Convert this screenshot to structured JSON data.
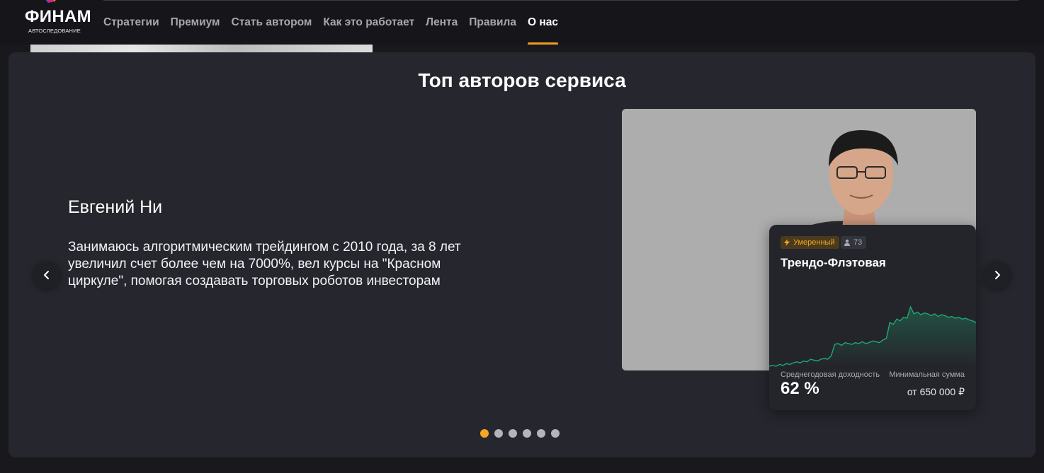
{
  "brand": {
    "name": "ФИНАМ",
    "subtitle": "АВТОСЛЕДОВАНИЕ",
    "colors": {
      "mark_orange": "#f5a623",
      "mark_purple": "#8e3bd6",
      "mark_red": "#e0245e"
    }
  },
  "nav": {
    "items": [
      {
        "label": "Стратегии",
        "active": false
      },
      {
        "label": "Премиум",
        "active": false
      },
      {
        "label": "Стать автором",
        "active": false
      },
      {
        "label": "Как это работает",
        "active": false
      },
      {
        "label": "Лента",
        "active": false
      },
      {
        "label": "Правила",
        "active": false
      },
      {
        "label": "О нас",
        "active": true
      }
    ],
    "active_color": "#f49b23"
  },
  "section": {
    "title": "Топ авторов сервиса"
  },
  "author": {
    "name": "Евгений Ни",
    "bio": "Занимаюсь алгоритмическим трейдингом с 2010 года, за 8 лет увеличил счет более чем на 7000%, вел курсы на \"Красном циркуле\", помогая создавать торговых роботов инвесторам"
  },
  "strategy": {
    "risk_label": "Умеренный",
    "risk_icon": "lightning-icon",
    "subscribers": "73",
    "subscribers_icon": "user-icon",
    "name": "Трендо-Флэтовая",
    "yield_label": "Среднегодовая доходность",
    "yield_value": "62 %",
    "min_label": "Минимальная сумма",
    "min_value": "от 650 000 ₽",
    "line_color": "#1fa971"
  },
  "carousel": {
    "prev_icon": "chevron-left-icon",
    "next_icon": "chevron-right-icon",
    "slides_total": 6,
    "active_slide": 1,
    "dot_active_color": "#f5a623"
  },
  "chart_data": {
    "type": "area",
    "title": "",
    "xlabel": "",
    "ylabel": "",
    "series": [
      {
        "values": [
          10,
          11,
          10,
          12,
          11,
          13,
          12,
          14,
          15,
          14,
          16,
          15,
          18,
          17,
          16,
          18,
          19,
          18,
          22,
          35,
          36,
          34,
          37,
          36,
          35,
          37,
          36,
          38,
          36,
          37,
          39,
          38,
          37,
          40,
          42,
          60,
          58,
          64,
          62,
          66,
          65,
          78,
          70,
          72,
          69,
          71,
          70,
          68,
          70,
          67,
          69,
          68,
          66,
          67,
          65,
          66,
          64,
          65,
          63,
          62,
          60
        ]
      }
    ]
  }
}
